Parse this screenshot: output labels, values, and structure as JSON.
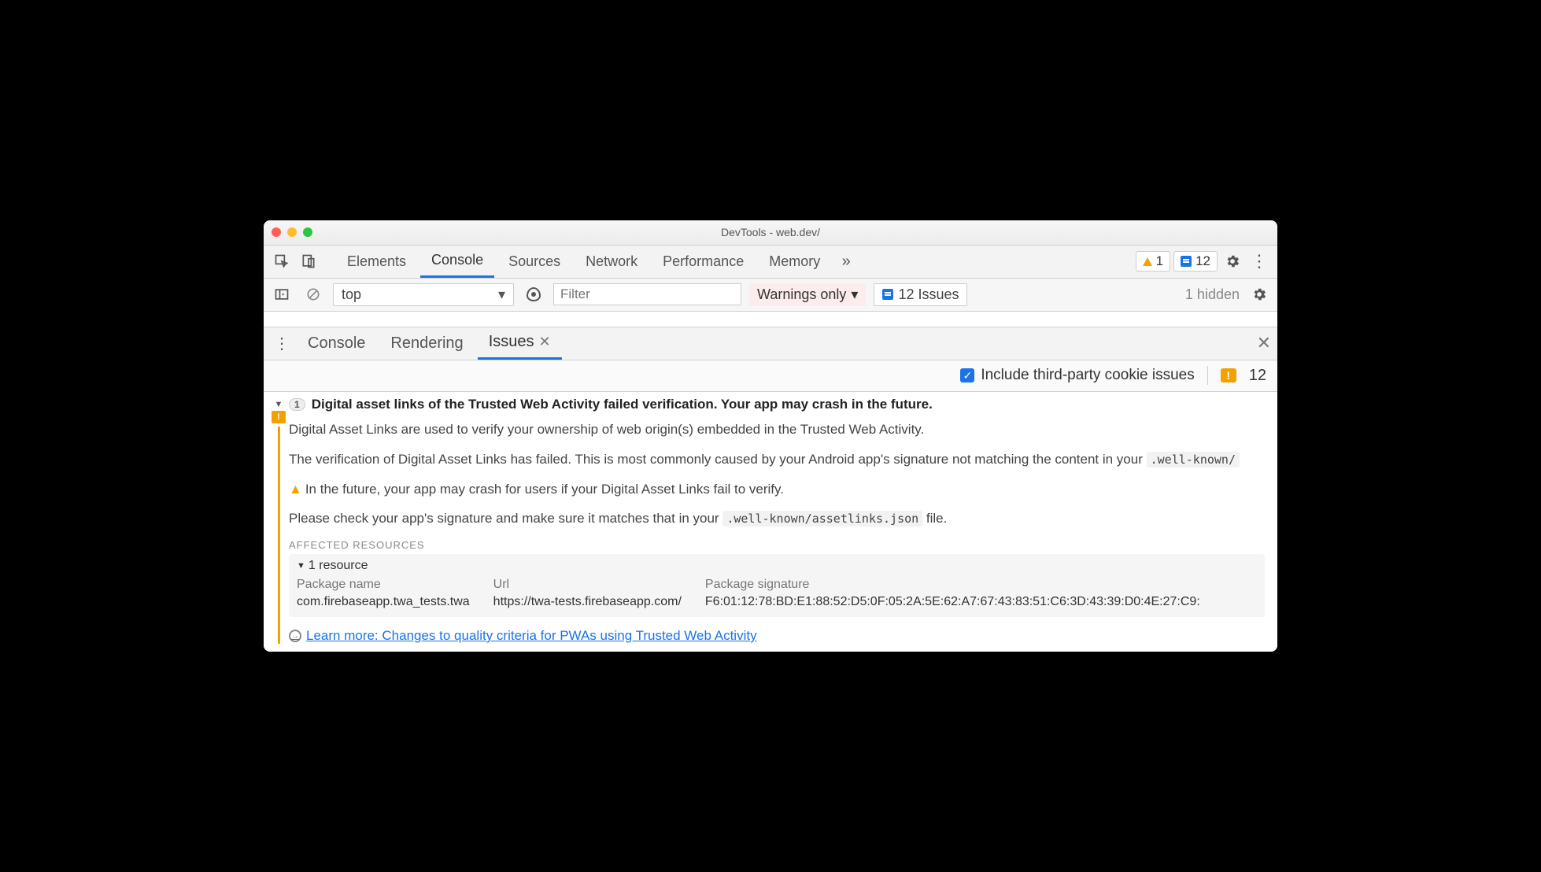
{
  "window": {
    "title": "DevTools - web.dev/"
  },
  "tabs": {
    "items": [
      "Elements",
      "Console",
      "Sources",
      "Network",
      "Performance",
      "Memory"
    ],
    "active": "Console"
  },
  "badges": {
    "warnings": "1",
    "messages": "12"
  },
  "console_toolbar": {
    "context": "top",
    "filter_placeholder": "Filter",
    "level": "Warnings only",
    "issues_count": "12 Issues",
    "hidden": "1 hidden"
  },
  "drawer": {
    "items": [
      "Console",
      "Rendering",
      "Issues"
    ],
    "active": "Issues"
  },
  "issues_toolbar": {
    "include_label": "Include third-party cookie issues",
    "count": "12"
  },
  "issue": {
    "count_badge": "1",
    "title": "Digital asset links of the Trusted Web Activity failed verification. Your app may crash in the future.",
    "p1": "Digital Asset Links are used to verify your ownership of web origin(s) embedded in the Trusted Web Activity.",
    "p2_prefix": "The verification of Digital Asset Links has failed. This is most commonly caused by your Android app's signature not matching the content in your ",
    "p2_code": ".well-known/",
    "p3": "In the future, your app may crash for users if your Digital Asset Links fail to verify.",
    "p4_prefix": "Please check your app's signature and make sure it matches that in your ",
    "p4_code": ".well-known/assetlinks.json",
    "p4_suffix": " file.",
    "affected_heading": "Affected Resources",
    "resource_toggle": "1 resource",
    "table": {
      "headers": {
        "pkg": "Package name",
        "url": "Url",
        "sig": "Package signature"
      },
      "row": {
        "pkg": "com.firebaseapp.twa_tests.twa",
        "url": "https://twa-tests.firebaseapp.com/",
        "sig": "F6:01:12:78:BD:E1:88:52:D5:0F:05:2A:5E:62:A7:67:43:83:51:C6:3D:43:39:D0:4E:27:C9:"
      }
    },
    "learn_more": "Learn more: Changes to quality criteria for PWAs using Trusted Web Activity"
  }
}
